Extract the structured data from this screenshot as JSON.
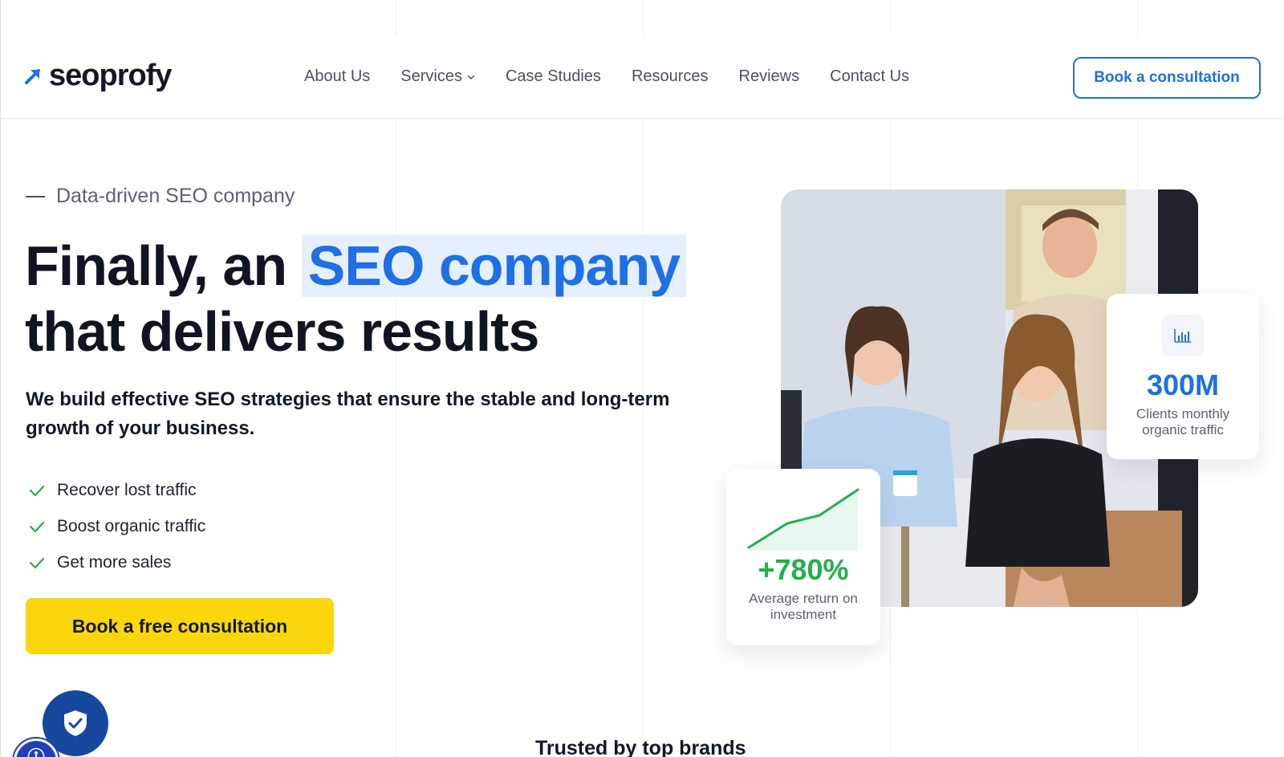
{
  "header": {
    "logo_text": "seoprofy",
    "nav": [
      {
        "label": "About Us",
        "has_dropdown": false
      },
      {
        "label": "Services",
        "has_dropdown": true
      },
      {
        "label": "Case Studies",
        "has_dropdown": false
      },
      {
        "label": "Resources",
        "has_dropdown": false
      },
      {
        "label": "Reviews",
        "has_dropdown": false
      },
      {
        "label": "Contact Us",
        "has_dropdown": false
      }
    ],
    "cta_label": "Book a consultation"
  },
  "hero": {
    "eyebrow": "Data-driven SEO company",
    "headline_part1": "Finally, an ",
    "headline_highlight": "SEO company",
    "headline_part2": "that delivers results",
    "subheadline": "We build effective SEO strategies that ensure the stable and long-term growth of your business.",
    "bullets": [
      "Recover lost traffic",
      "Boost organic traffic",
      "Get more sales"
    ],
    "cta_label": "Book a free consultation"
  },
  "stats": {
    "traffic": {
      "value": "300M",
      "description": "Clients monthly organic traffic",
      "icon": "bar-chart-icon"
    },
    "roi": {
      "value": "+780%",
      "description": "Average return on investment",
      "icon": "growth-line-icon"
    }
  },
  "bottom": {
    "trusted_heading": "Trusted by top brands"
  },
  "colors": {
    "accent_blue": "#1f6fe5",
    "cta_yellow": "#fcd60c",
    "success_green": "#22b04b",
    "highlight_bg": "#e6f0fd",
    "text_dark": "#0f1522"
  }
}
